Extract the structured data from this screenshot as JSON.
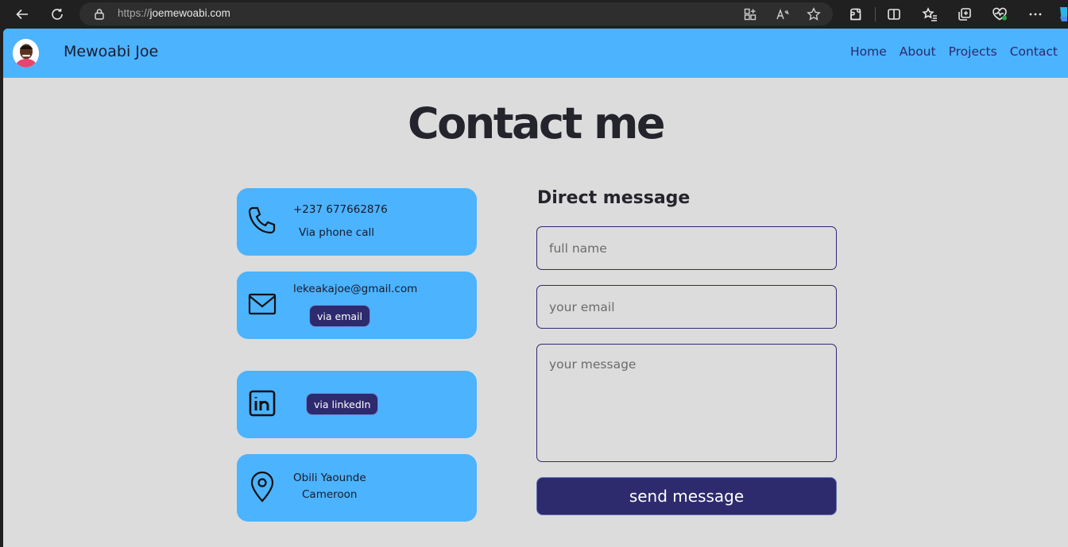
{
  "browser": {
    "url_protocol": "https://",
    "url_host": "joemewoabi.com"
  },
  "nav": {
    "brand": "Mewoabi Joe",
    "links": [
      "Home",
      "About",
      "Projects",
      "Contact"
    ]
  },
  "page_title": "Contact me",
  "contacts": {
    "phone": {
      "value": "+237 677662876",
      "label": "Via phone call"
    },
    "email": {
      "value": "lekeakajoe@gmail.com",
      "button": "via email"
    },
    "linkedin": {
      "button": "via linkedIn"
    },
    "location": {
      "line1": "Obili Yaounde",
      "line2": "Cameroon"
    }
  },
  "form": {
    "title": "Direct message",
    "name_placeholder": "full name",
    "email_placeholder": "your email",
    "message_placeholder": "your message",
    "submit_label": "send message"
  },
  "colors": {
    "nav_bg": "#4cb3fe",
    "page_bg": "#dcdcdc",
    "accent_dark": "#2d2a6e"
  }
}
